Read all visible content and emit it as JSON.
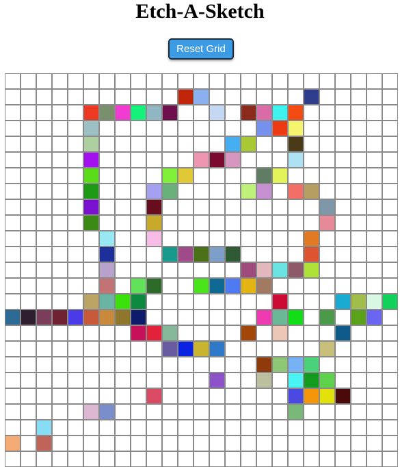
{
  "title": "Etch-A-Sketch",
  "reset_label": "Reset Grid",
  "grid": {
    "columns": 25,
    "rows": 25,
    "empty_color": "#ffffff",
    "border_color": "#8a8a8a",
    "colored_cells": {
      "1,11": "#c0250a",
      "1,12": "#8ab0f0",
      "1,19": "#2e3d8c",
      "2,5": "#ee3a22",
      "2,6": "#7a906c",
      "2,7": "#f23bd0",
      "2,8": "#15f27b",
      "2,9": "#90b6c4",
      "2,10": "#6e0f4e",
      "2,13": "#c4d8f4",
      "2,15": "#8b2b1c",
      "2,16": "#d96ca8",
      "2,17": "#3ef2ee",
      "2,18": "#f34c12",
      "3,5": "#9dc0c4",
      "3,16": "#7690ee",
      "3,17": "#ee3a12",
      "3,18": "#f4f46e",
      "4,5": "#aed0a0",
      "4,14": "#44aef0",
      "4,15": "#a8c834",
      "4,18": "#4a3a18",
      "5,5": "#a312ee",
      "5,12": "#ee96b0",
      "5,13": "#7a0a30",
      "5,14": "#d696c0",
      "5,18": "#aee2f2",
      "6,5": "#5adc1a",
      "6,10": "#7ef038",
      "6,11": "#e0c836",
      "6,16": "#607c62",
      "6,17": "#e2f45a",
      "7,5": "#1f9a16",
      "7,9": "#a6a0f0",
      "7,10": "#6ab07a",
      "7,15": "#bff07a",
      "7,16": "#c690d2",
      "7,18": "#f26e66",
      "7,19": "#b69e62",
      "8,5": "#7a10d0",
      "8,9": "#680d1e",
      "8,20": "#7e98aa",
      "9,5": "#3a8a14",
      "9,9": "#c8aa2a",
      "9,20": "#e68a98",
      "10,6": "#98e8f4",
      "10,9": "#f6bce6",
      "10,19": "#e27a24",
      "11,6": "#1d2f9a",
      "11,10": "#17998c",
      "11,11": "#a04a8a",
      "11,12": "#4a7018",
      "11,13": "#7c9ec8",
      "11,14": "#2e5a34",
      "11,19": "#dc5430",
      "12,6": "#b8a2cc",
      "12,15": "#9e4a7a",
      "12,16": "#e2b8bc",
      "12,17": "#6ae2e2",
      "12,18": "#8e5a6a",
      "12,19": "#aee23a",
      "13,6": "#c27474",
      "13,8": "#62e25a",
      "13,9": "#2e6a2a",
      "13,12": "#4ae41a",
      "13,13": "#0e6a94",
      "13,14": "#4e7af4",
      "13,15": "#e4b412",
      "13,16": "#a27a62",
      "14,5": "#bca466",
      "14,6": "#6ab4a2",
      "14,7": "#3ae00a",
      "14,8": "#0e8a40",
      "14,17": "#cc0a34",
      "14,21": "#1aaad2",
      "14,22": "#a2be4a",
      "14,23": "#d8f8e2",
      "14,24": "#10d25a",
      "14,25": "#8e7a82",
      "15,0": "#2e6a96",
      "15,1": "#2e1e2e",
      "15,2": "#7a3e5a",
      "15,3": "#6e2232",
      "15,4": "#4a3ae8",
      "15,5": "#c85a3a",
      "15,6": "#c88a3a",
      "15,7": "#8e762a",
      "15,8": "#0e1a6a",
      "15,16": "#ee3ab0",
      "15,17": "#6ab896",
      "15,18": "#12de18",
      "15,20": "#4a9a4a",
      "15,22": "#5aa21a",
      "15,23": "#6a66f2",
      "16,8": "#c8105a",
      "16,9": "#e4213a",
      "16,10": "#86b89a",
      "16,15": "#a2460a",
      "16,17": "#ecc6b6",
      "16,21": "#0e5a8a",
      "17,10": "#6a5aa2",
      "17,11": "#0a22e2",
      "17,12": "#c8b42e",
      "17,13": "#2e7ac8",
      "17,20": "#c8c07a",
      "18,16": "#8e3a0a",
      "18,17": "#8ec876",
      "18,18": "#76b2f4",
      "18,19": "#4ad27a",
      "19,13": "#8e52c8",
      "19,16": "#bcc09e",
      "19,18": "#4af4f4",
      "19,19": "#149a1e",
      "19,20": "#5ed24a",
      "20,9": "#da4a62",
      "20,18": "#4a4ae2",
      "20,19": "#f4960a",
      "20,20": "#e2e20a",
      "20,21": "#4a0a0a",
      "21,5": "#ddb8d2",
      "21,6": "#7a8ecc",
      "21,18": "#7ab87a",
      "22,2": "#88dcf4",
      "23,0": "#f4ac74",
      "23,2": "#c0645a"
    }
  }
}
